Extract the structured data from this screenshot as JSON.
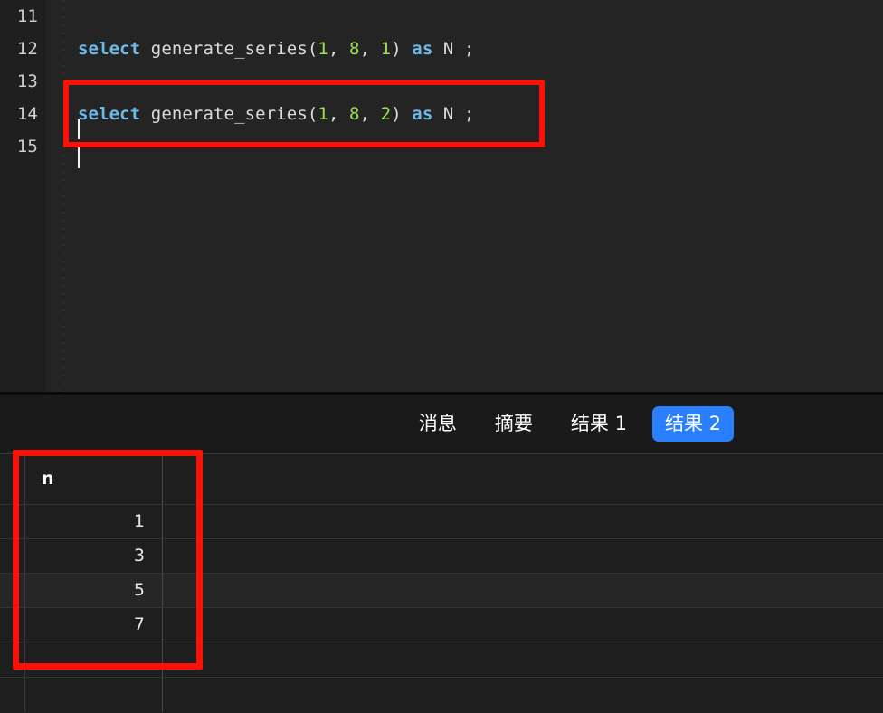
{
  "editor": {
    "line_numbers": [
      "11",
      "12",
      "13",
      "14",
      "15"
    ],
    "lines": [
      {
        "number": "11",
        "tokens": []
      },
      {
        "number": "12",
        "tokens": [
          {
            "t": "select",
            "k": "kw"
          },
          {
            "t": " ",
            "k": "pun"
          },
          {
            "t": "generate_series",
            "k": "id"
          },
          {
            "t": "(",
            "k": "pun"
          },
          {
            "t": "1",
            "k": "num"
          },
          {
            "t": ", ",
            "k": "pun"
          },
          {
            "t": "8",
            "k": "num"
          },
          {
            "t": ", ",
            "k": "pun"
          },
          {
            "t": "1",
            "k": "num"
          },
          {
            "t": ") ",
            "k": "pun"
          },
          {
            "t": "as",
            "k": "kw"
          },
          {
            "t": " N ;",
            "k": "pun"
          }
        ]
      },
      {
        "number": "13",
        "tokens": []
      },
      {
        "number": "14",
        "tokens": [
          {
            "t": "select",
            "k": "kw"
          },
          {
            "t": " ",
            "k": "pun"
          },
          {
            "t": "generate_series",
            "k": "id"
          },
          {
            "t": "(",
            "k": "pun"
          },
          {
            "t": "1",
            "k": "num"
          },
          {
            "t": ", ",
            "k": "pun"
          },
          {
            "t": "8",
            "k": "num"
          },
          {
            "t": ", ",
            "k": "pun"
          },
          {
            "t": "2",
            "k": "num"
          },
          {
            "t": ") ",
            "k": "pun"
          },
          {
            "t": "as",
            "k": "kw"
          },
          {
            "t": " N ;",
            "k": "pun"
          }
        ]
      },
      {
        "number": "15",
        "tokens": []
      }
    ],
    "line_12_text": "select generate_series(1, 8, 1) as N ;",
    "line_14_text": "select generate_series(1, 8, 2) as N ;"
  },
  "results": {
    "tabs": [
      {
        "label": "消息",
        "active": false
      },
      {
        "label": "摘要",
        "active": false
      },
      {
        "label": "结果 1",
        "active": false
      },
      {
        "label": "结果 2",
        "active": true
      }
    ],
    "active_tab": "结果 2",
    "grid": {
      "columns": [
        "n"
      ],
      "rows": [
        {
          "n": "1"
        },
        {
          "n": "3"
        },
        {
          "n": "5"
        },
        {
          "n": "7"
        }
      ],
      "highlighted_row_index": 2
    }
  },
  "annotations": {
    "color": "#fc1108",
    "code_box_target": "select generate_series(1, 8, 2) as N ;",
    "table_box_target": "n column results 1 3 5 7"
  },
  "theme": {
    "editor_background": "#242424",
    "gutter_background": "#1f1f1f",
    "results_background": "#1e1e1e",
    "keyword_color": "#6cb8e6",
    "number_color": "#9fe05a",
    "text_color": "#dcdcdc",
    "accent_blue": "#2a7fff"
  }
}
